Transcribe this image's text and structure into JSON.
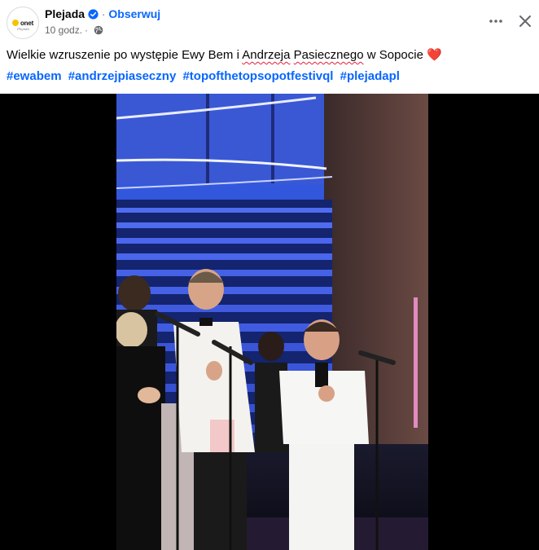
{
  "post": {
    "page_name": "Plejada",
    "follow_label": "Obserwuj",
    "separator": "·",
    "time": "10 godz.",
    "avatar_logo": "onet",
    "avatar_sub": "Plejada",
    "caption_before": "Wielkie wzruszenie po występie Ewy Bem i ",
    "caption_word1": "Andrzeja",
    "caption_space": " ",
    "caption_word2": "Pasiecznego",
    "caption_after": " w Sopocie ",
    "caption_emoji": "❤️",
    "hashtags": [
      "#ewabem",
      "#andrzejpiaseczny",
      "#topofthetopsopotfestivql",
      "#plejadapl"
    ]
  },
  "icons": {
    "verified": "verified-badge-icon",
    "privacy": "globe-icon",
    "more": "more-options-icon",
    "close": "close-icon"
  },
  "colors": {
    "link": "#0866ff",
    "secondary_text": "#65676b",
    "heart": "#e41e3f",
    "video_background": "#000000"
  }
}
